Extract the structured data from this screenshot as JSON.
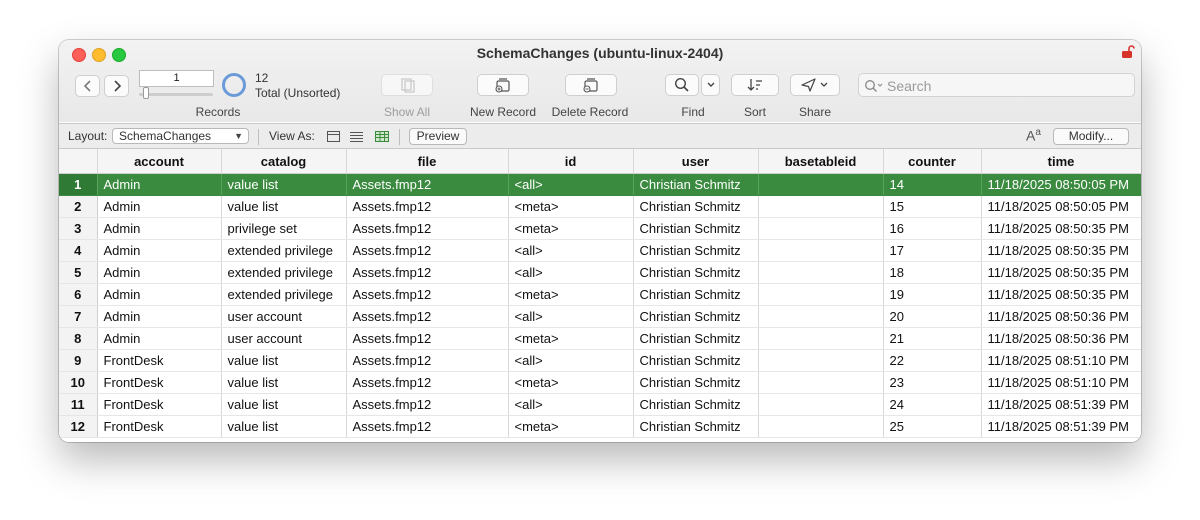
{
  "window": {
    "title": "SchemaChanges (ubuntu-linux-2404)"
  },
  "toolbar": {
    "current_record": "1",
    "record_count": "12",
    "record_status": "Total (Unsorted)",
    "records_label": "Records",
    "show_all_label": "Show All",
    "new_record_label": "New Record",
    "delete_record_label": "Delete Record",
    "find_label": "Find",
    "sort_label": "Sort",
    "share_label": "Share",
    "search_placeholder": "Search"
  },
  "layoutbar": {
    "layout_label": "Layout:",
    "layout_value": "SchemaChanges",
    "view_as_label": "View As:",
    "preview_label": "Preview",
    "modify_label": "Modify..."
  },
  "table": {
    "columns": [
      "account",
      "catalog",
      "file",
      "id",
      "user",
      "basetableid",
      "counter",
      "time"
    ],
    "selected_row": 1,
    "rows": [
      {
        "num": "1",
        "cells": [
          "Admin",
          "value list",
          "Assets.fmp12",
          "<all>",
          "Christian Schmitz",
          "",
          "14",
          "11/18/2025 08:50:05 PM"
        ]
      },
      {
        "num": "2",
        "cells": [
          "Admin",
          "value list",
          "Assets.fmp12",
          "<meta>",
          "Christian Schmitz",
          "",
          "15",
          "11/18/2025 08:50:05 PM"
        ]
      },
      {
        "num": "3",
        "cells": [
          "Admin",
          "privilege set",
          "Assets.fmp12",
          "<meta>",
          "Christian Schmitz",
          "",
          "16",
          "11/18/2025 08:50:35 PM"
        ]
      },
      {
        "num": "4",
        "cells": [
          "Admin",
          "extended privilege",
          "Assets.fmp12",
          "<all>",
          "Christian Schmitz",
          "",
          "17",
          "11/18/2025 08:50:35 PM"
        ]
      },
      {
        "num": "5",
        "cells": [
          "Admin",
          "extended privilege",
          "Assets.fmp12",
          "<all>",
          "Christian Schmitz",
          "",
          "18",
          "11/18/2025 08:50:35 PM"
        ]
      },
      {
        "num": "6",
        "cells": [
          "Admin",
          "extended privilege",
          "Assets.fmp12",
          "<meta>",
          "Christian Schmitz",
          "",
          "19",
          "11/18/2025 08:50:35 PM"
        ]
      },
      {
        "num": "7",
        "cells": [
          "Admin",
          "user account",
          "Assets.fmp12",
          "<all>",
          "Christian Schmitz",
          "",
          "20",
          "11/18/2025 08:50:36 PM"
        ]
      },
      {
        "num": "8",
        "cells": [
          "Admin",
          "user account",
          "Assets.fmp12",
          "<meta>",
          "Christian Schmitz",
          "",
          "21",
          "11/18/2025 08:50:36 PM"
        ]
      },
      {
        "num": "9",
        "cells": [
          "FrontDesk",
          "value list",
          "Assets.fmp12",
          "<all>",
          "Christian Schmitz",
          "",
          "22",
          "11/18/2025 08:51:10 PM"
        ]
      },
      {
        "num": "10",
        "cells": [
          "FrontDesk",
          "value list",
          "Assets.fmp12",
          "<meta>",
          "Christian Schmitz",
          "",
          "23",
          "11/18/2025 08:51:10 PM"
        ]
      },
      {
        "num": "11",
        "cells": [
          "FrontDesk",
          "value list",
          "Assets.fmp12",
          "<all>",
          "Christian Schmitz",
          "",
          "24",
          "11/18/2025 08:51:39 PM"
        ]
      },
      {
        "num": "12",
        "cells": [
          "FrontDesk",
          "value list",
          "Assets.fmp12",
          "<meta>",
          "Christian Schmitz",
          "",
          "25",
          "11/18/2025 08:51:39 PM"
        ]
      }
    ]
  },
  "colors": {
    "selection": "#3a8a3f",
    "close": "#fe5f57",
    "minimize": "#febc2e",
    "zoom": "#28c840",
    "lock": "#d8332b"
  },
  "icons": [
    "close-icon",
    "minimize-icon",
    "zoom-icon",
    "lock-icon",
    "chevron-left-icon",
    "chevron-right-icon",
    "pie-icon",
    "show-all-icon",
    "new-record-icon",
    "delete-record-icon",
    "find-icon",
    "chevron-down-icon",
    "sort-icon",
    "share-icon",
    "search-icon",
    "form-view-icon",
    "list-view-icon",
    "table-view-icon",
    "font-size-icon"
  ]
}
